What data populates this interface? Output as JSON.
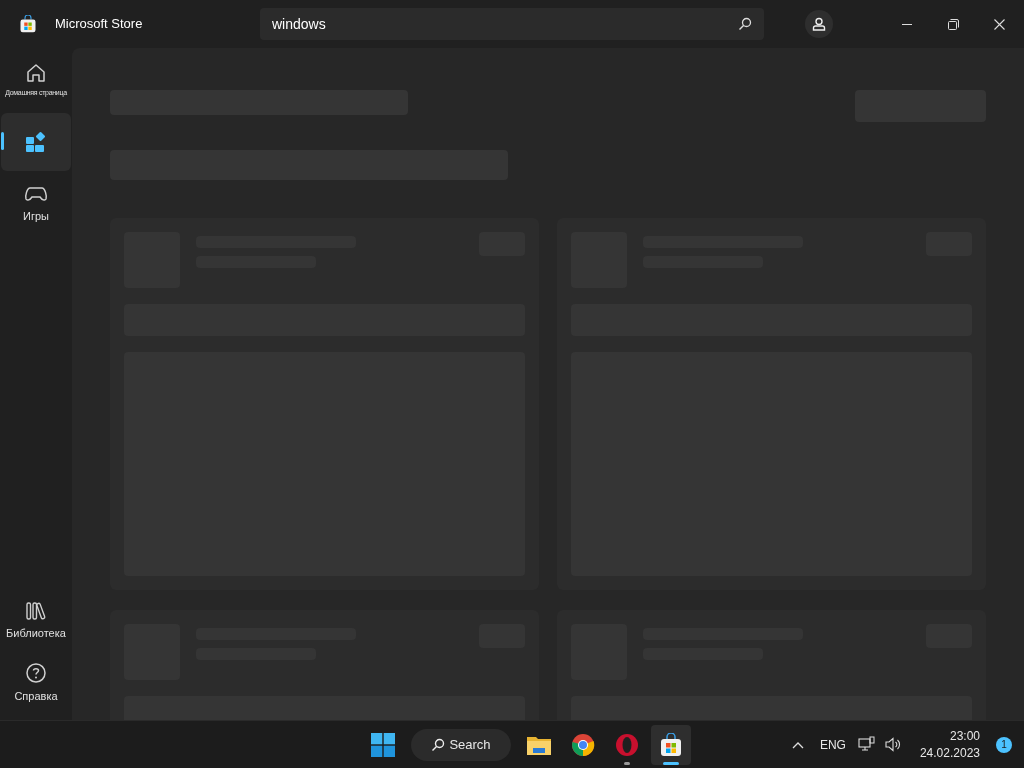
{
  "window": {
    "title": "Microsoft Store"
  },
  "search": {
    "value": "windows"
  },
  "sidebar": {
    "items": [
      {
        "kind": "home",
        "label": "Домашняя страница",
        "selected": false
      },
      {
        "kind": "apps",
        "selected": true
      },
      {
        "kind": "games",
        "label": "Игры",
        "selected": false
      }
    ],
    "bottom_items": [
      {
        "kind": "library",
        "label": "Библиотека",
        "selected": false
      },
      {
        "kind": "help",
        "label": "Справка",
        "selected": false
      }
    ]
  },
  "taskbar": {
    "search_label": "Search",
    "apps": [
      {
        "kind": "explorer",
        "running": false,
        "selected": false
      },
      {
        "kind": "chrome",
        "running": false,
        "selected": false
      },
      {
        "kind": "opera",
        "running": true,
        "selected": false
      },
      {
        "kind": "store",
        "running": true,
        "selected": true
      }
    ],
    "language": "ENG",
    "time": "23:00",
    "date": "24.02.2023",
    "notifications": "1"
  }
}
